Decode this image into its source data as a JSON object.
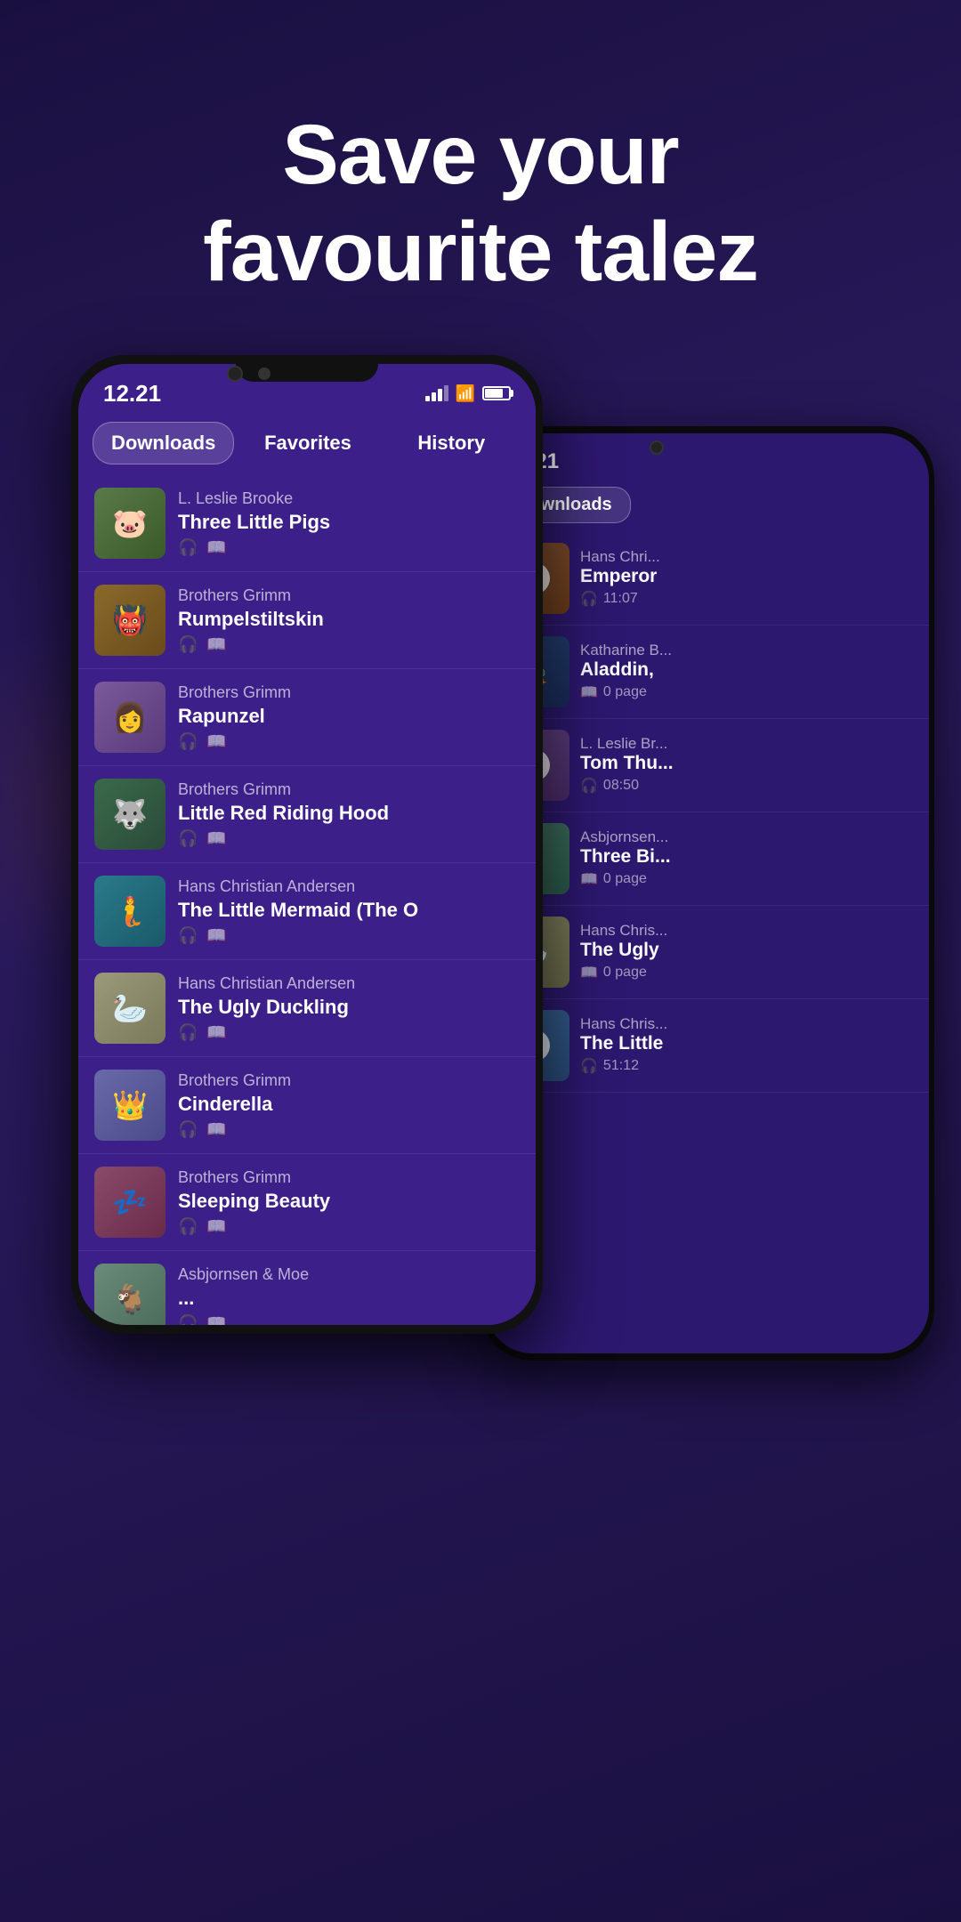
{
  "hero": {
    "line1": "Save your",
    "line2": "favourite talez"
  },
  "phone1": {
    "statusBar": {
      "time": "12.21",
      "label": "Downloads"
    },
    "tabs": [
      {
        "label": "Downloads",
        "active": true
      },
      {
        "label": "Favorites",
        "active": false
      },
      {
        "label": "History",
        "active": false
      }
    ],
    "stories": [
      {
        "author": "L. Leslie Brooke",
        "title": "Three Little Pigs",
        "thumbClass": "thumb-pigs"
      },
      {
        "author": "Brothers Grimm",
        "title": "Rumpelstiltskin",
        "thumbClass": "thumb-rumpel"
      },
      {
        "author": "Brothers Grimm",
        "title": "Rapunzel",
        "thumbClass": "thumb-rapunzel"
      },
      {
        "author": "Brothers Grimm",
        "title": "Little Red Riding Hood",
        "thumbClass": "thumb-lrrh"
      },
      {
        "author": "Hans Christian Andersen",
        "title": "The Little Mermaid (The O",
        "thumbClass": "thumb-mermaid"
      },
      {
        "author": "Hans Christian Andersen",
        "title": "The Ugly Duckling",
        "thumbClass": "thumb-ugly"
      },
      {
        "author": "Brothers Grimm",
        "title": "Cinderella",
        "thumbClass": "thumb-cinderella"
      },
      {
        "author": "Brothers Grimm",
        "title": "Sleeping Beauty",
        "thumbClass": "thumb-sleeping"
      },
      {
        "author": "Asbjornsen & Moe",
        "title": "...",
        "thumbClass": "thumb-asbjornsen"
      }
    ]
  },
  "phone2": {
    "statusBar": {
      "time": "12.21"
    },
    "tab": "Downloads",
    "stories": [
      {
        "author": "Hans Chri...",
        "title": "Emperor",
        "meta": "11:07",
        "metaType": "audio",
        "thumbClass": "thumb-emperor",
        "hasPlay": true
      },
      {
        "author": "Katharine B...",
        "title": "Aladdin,",
        "meta": "0 page",
        "metaType": "book",
        "thumbClass": "thumb-aladdin",
        "hasPlay": false
      },
      {
        "author": "L. Leslie Br...",
        "title": "Tom Thu...",
        "meta": "08:50",
        "metaType": "audio",
        "thumbClass": "thumb-tom",
        "hasPlay": true
      },
      {
        "author": "Asbjornsen...",
        "title": "Three Bi...",
        "meta": "0 page",
        "metaType": "book",
        "thumbClass": "thumb-three-bil",
        "hasPlay": false
      },
      {
        "author": "Hans Chris...",
        "title": "The Ugly",
        "meta": "0 page",
        "metaType": "book",
        "thumbClass": "thumb-ugly2",
        "hasPlay": false
      },
      {
        "author": "Hans Chris...",
        "title": "The Little",
        "meta": "51:12",
        "metaType": "audio",
        "thumbClass": "thumb-little-m",
        "hasPlay": true
      }
    ]
  }
}
